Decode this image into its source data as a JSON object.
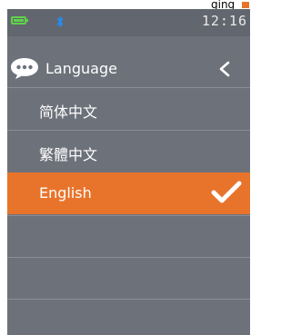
{
  "top_strip": {
    "text": "ging",
    "mark_color": "#e8742c"
  },
  "statusbar": {
    "battery_icon": "battery-icon",
    "bluetooth_icon": "bluetooth-icon",
    "time": "12:16"
  },
  "header": {
    "icon": "speech-bubble-icon",
    "title": "Language",
    "back_icon": "chevron-left-icon"
  },
  "languages": [
    {
      "label": "简体中文",
      "selected": false
    },
    {
      "label": "繁體中文",
      "selected": false
    },
    {
      "label": "English",
      "selected": true
    }
  ],
  "colors": {
    "accent": "#e8742c",
    "background": "#6d717a",
    "statusbar": "#62666e",
    "battery": "#5fd24a",
    "bluetooth": "#1f8fff"
  }
}
